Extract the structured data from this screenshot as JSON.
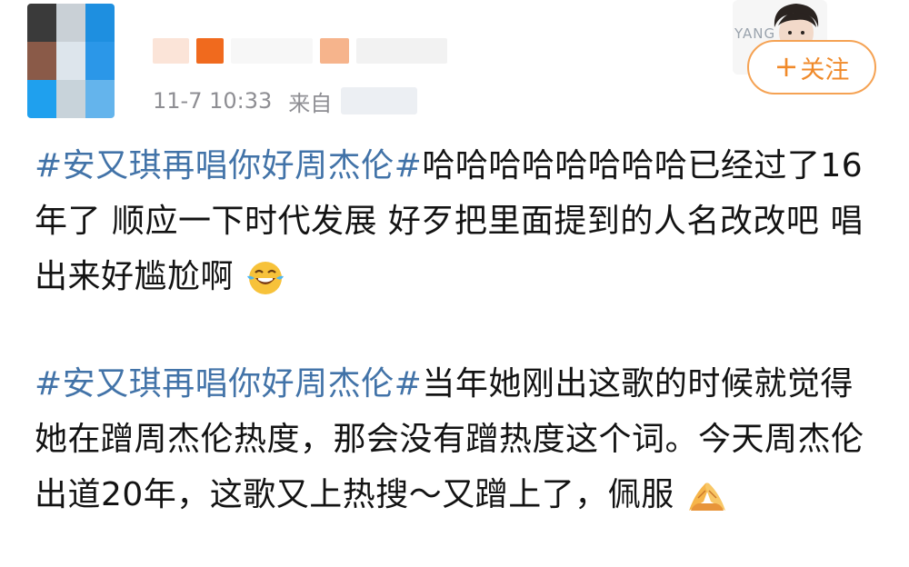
{
  "post": {
    "author": {
      "avatar_tile_colors": [
        "#3a3a3a",
        "#c9d0d6",
        "#1e8fe0",
        "#8a5a48",
        "#dde5ec",
        "#2b97e8",
        "#1fa0ee",
        "#c8d3da",
        "#64b4ec"
      ],
      "name_blur_colors": [
        "#fbe4d8",
        "#f06a1e",
        "#f7f7f7",
        "#f6b48c",
        "#f2f2f2"
      ]
    },
    "timestamp": "11-7 10:33",
    "source_prefix": "来自",
    "follow_button": {
      "icon": "plus-icon",
      "plus": "+",
      "label": "关注",
      "border_color": "#f5a253",
      "text_color": "#f08a2a"
    },
    "profile_thumb": {
      "brand_text": "YANG"
    },
    "paragraph1": {
      "topic": "#安又琪再唱你好周杰伦#",
      "text": "哈哈哈哈哈哈哈哈已经过了16年了  顺应一下时代发展   好歹把里面提到的人名改改吧  唱出来好尴尬啊",
      "emoji": "laughing-tears-emoji"
    },
    "paragraph2": {
      "topic": "#安又琪再唱你好周杰伦#",
      "text": "当年她刚出这歌的时候就觉得她在蹭周杰伦热度，那会没有蹭热度这个词。今天周杰伦出道20年，这歌又上热搜～又蹭上了，佩服",
      "emoji": "praying-hands-emoji"
    },
    "colors": {
      "topic_link": "#4273a8",
      "meta_text": "#8e8e93",
      "body_text": "#131313"
    }
  }
}
